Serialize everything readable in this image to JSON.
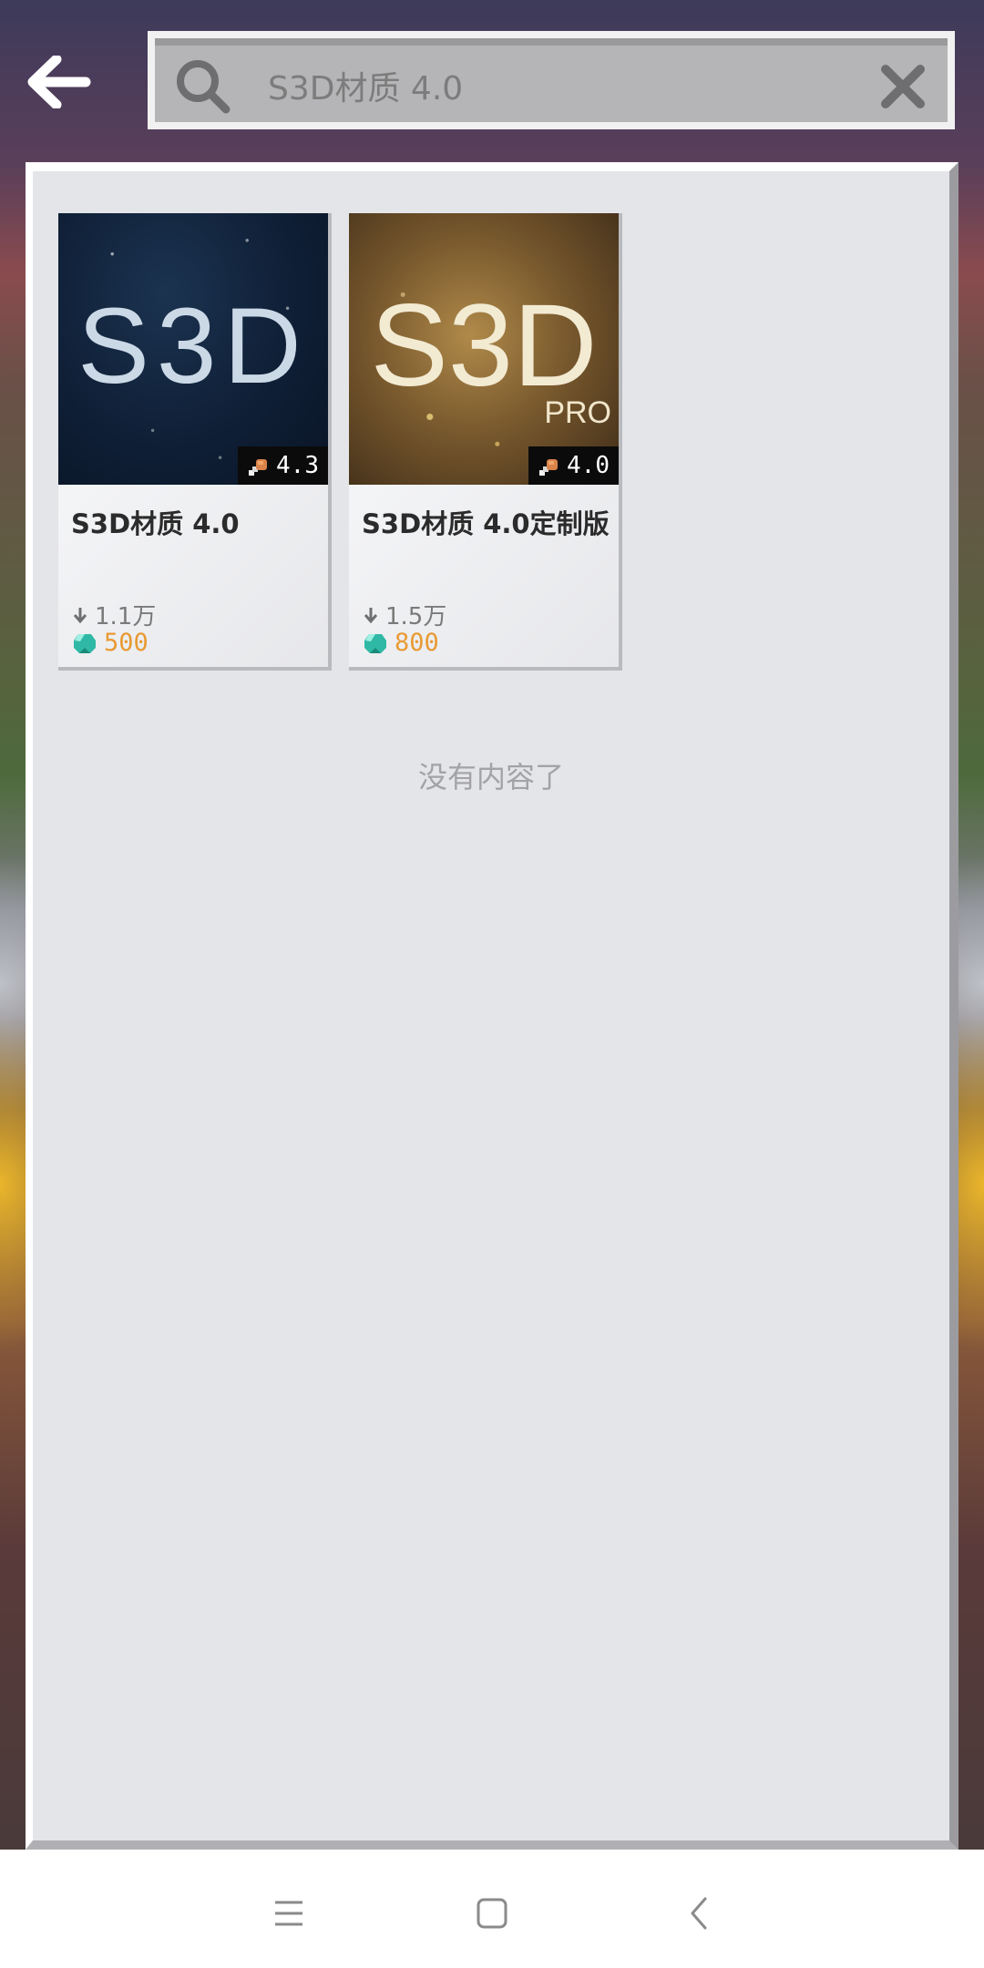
{
  "search": {
    "query": "S3D材质 4.0"
  },
  "results": [
    {
      "thumb_text": "S3D",
      "thumb_subtext": "",
      "rating": "4.3",
      "title": "S3D材质 4.0",
      "downloads": "1.1万",
      "price": "500"
    },
    {
      "thumb_text": "S3D",
      "thumb_subtext": "PRO",
      "rating": "4.0",
      "title": "S3D材质 4.0定制版",
      "downloads": "1.5万",
      "price": "800"
    }
  ],
  "empty_message": "没有内容了",
  "icons": {
    "back": "back-arrow-icon",
    "search": "search-icon",
    "clear": "close-icon",
    "rating": "drumstick-icon",
    "downloads": "download-arrow-icon",
    "currency": "diamond-icon",
    "nav_menu": "menu-icon",
    "nav_home": "home-square-icon",
    "nav_back": "chevron-left-icon"
  },
  "colors": {
    "panel_bg": "#e4e5e9",
    "price": "#e89a34",
    "rating_bg": "#0b0b0b"
  }
}
